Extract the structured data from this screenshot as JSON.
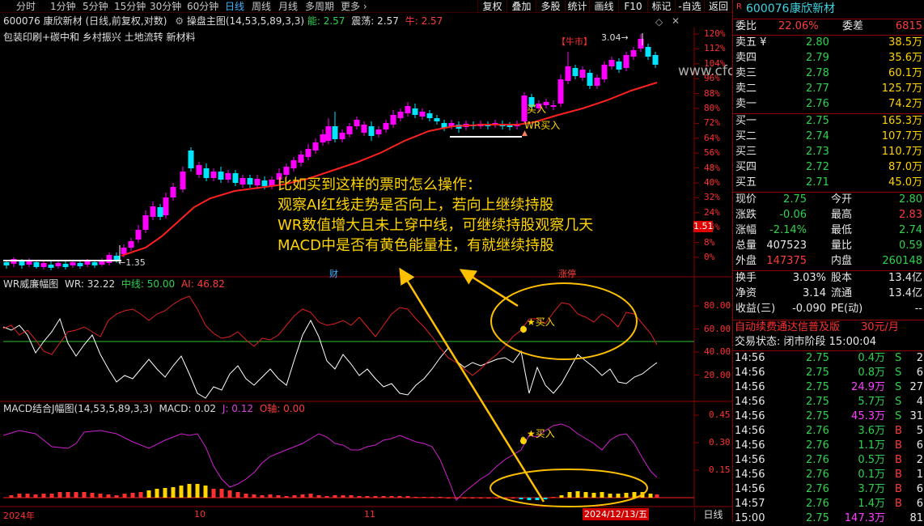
{
  "toolbar": {
    "periods": [
      "分时",
      "1分钟",
      "5分钟",
      "15分钟",
      "30分钟",
      "60分钟",
      "日线",
      "周线",
      "月线",
      "多周期",
      "更多 ›"
    ],
    "selected_period": "日线",
    "buttons": [
      "复权",
      "叠加",
      "多股",
      "统计",
      "画线",
      "F10",
      "标记",
      "-自选",
      "返回"
    ]
  },
  "main_panel": {
    "title": "600076 康欣新材 (日线,前复权,对数)",
    "indicator": "操盘主图(14,53,5,89,3,3)",
    "neng_label": "能:",
    "neng_value": "2.57",
    "zhen_label": "震荡:",
    "zhen_value": "2.57",
    "niu_label": "牛:",
    "niu_value": "2.57",
    "concepts": "包装印刷+碳中和 乡村振兴 土地流转 新材料",
    "pct_ticks": [
      "120%",
      "112%",
      "104%",
      "96%",
      "88%",
      "80%",
      "72%",
      "64%",
      "56%",
      "48%",
      "40%",
      "32%",
      "24%",
      "16%",
      "8%",
      "0%"
    ],
    "price_tag": "1.51",
    "low_label": "1.35",
    "high_label": "3.04",
    "niushi_label": "【牛市】",
    "buy_label": "买入",
    "wr_buy_label": "WR买入",
    "cai_label": "财",
    "zhangting_label": "涨停",
    "watermark": "www.cfchi.com"
  },
  "annotation": {
    "lines": [
      "比如买到这样的票时怎么操作：",
      "观察AI红线走势是否向上，若向上继续持股",
      "WR数值增大且未上穿中线，可继续持股观察几天",
      "MACD中是否有黄色能量柱，有就继续持股"
    ]
  },
  "wr_panel": {
    "title": "WR威廉幅图",
    "wr_label": "WR: 32.22",
    "mid_label": "中线: 50.00",
    "ai_label": "AI: 46.82",
    "ticks": [
      "80.00",
      "60.00",
      "40.00",
      "20.00"
    ],
    "buy_label": "★买入"
  },
  "macd_panel": {
    "title": "MACD结合J幅图(14,53,5,89,3,3)",
    "macd_label": "MACD: 0.02",
    "j_label": "J: 0.12",
    "o_label": "O轴: 0.00",
    "ticks": [
      "0.45",
      "0.30",
      "0.15"
    ],
    "buy_label": "★买入"
  },
  "xaxis": {
    "labels": [
      "2024年",
      "10",
      "11"
    ],
    "date_box": "2024/12/13/五",
    "period_btn": "日线"
  },
  "quote": {
    "code": "600076",
    "name": "康欣新材",
    "weibi_label": "委比",
    "weibi": "22.06%",
    "weicha_label": "委差",
    "weicha": "6815",
    "asks": [
      {
        "label": "卖五 ¥",
        "price": "2.80",
        "vol": "38.5万"
      },
      {
        "label": "卖四",
        "price": "2.79",
        "vol": "35.6万"
      },
      {
        "label": "卖三",
        "price": "2.78",
        "vol": "60.1万"
      },
      {
        "label": "卖二",
        "price": "2.77",
        "vol": "125.7万"
      },
      {
        "label": "卖一",
        "price": "2.76",
        "vol": "74.2万"
      }
    ],
    "bids": [
      {
        "label": "买一",
        "price": "2.75",
        "vol": "165.3万"
      },
      {
        "label": "买二",
        "price": "2.74",
        "vol": "107.7万"
      },
      {
        "label": "买三",
        "price": "2.73",
        "vol": "110.7万"
      },
      {
        "label": "买四",
        "price": "2.72",
        "vol": "87.0万"
      },
      {
        "label": "买五",
        "price": "2.71",
        "vol": "45.0万"
      }
    ],
    "stats": [
      {
        "l1": "现价",
        "v1": "2.75",
        "c1": "g",
        "l2": "今开",
        "v2": "2.80",
        "c2": "g"
      },
      {
        "l1": "涨跌",
        "v1": "-0.06",
        "c1": "g",
        "l2": "最高",
        "v2": "2.83",
        "c2": "r"
      },
      {
        "l1": "涨幅",
        "v1": "-2.14%",
        "c1": "g",
        "l2": "最低",
        "v2": "2.74",
        "c2": "g"
      },
      {
        "l1": "总量",
        "v1": "407523",
        "c1": "w",
        "l2": "量比",
        "v2": "0.59",
        "c2": "g"
      },
      {
        "l1": "外盘",
        "v1": "147375",
        "c1": "r",
        "l2": "内盘",
        "v2": "260148",
        "c2": "g"
      }
    ],
    "stats2": [
      {
        "l1": "换手",
        "v1": "3.03%",
        "l2": "股本",
        "v2": "13.4亿"
      },
      {
        "l1": "净资",
        "v1": "3.14",
        "l2": "流通",
        "v2": "13.4亿"
      },
      {
        "l1": "收益(三)",
        "v1": "-0.090",
        "l2": "PE(动)",
        "v2": "--"
      }
    ],
    "promo": "自动续费通达信普及版",
    "promo_price": "30元/月",
    "trade_status": "交易状态: 闭市阶段 15:00:04",
    "ticks": [
      {
        "t": "14:56",
        "p": "2.75",
        "v": "0.4万",
        "d": "S",
        "n": "2",
        "vc": "g"
      },
      {
        "t": "14:56",
        "p": "2.75",
        "v": "0.8万",
        "d": "S",
        "n": "6",
        "vc": "g"
      },
      {
        "t": "14:56",
        "p": "2.75",
        "v": "24.9万",
        "d": "S",
        "n": "27",
        "vc": "m"
      },
      {
        "t": "14:56",
        "p": "2.75",
        "v": "5.7万",
        "d": "S",
        "n": "4",
        "vc": "g"
      },
      {
        "t": "14:56",
        "p": "2.75",
        "v": "45.3万",
        "d": "S",
        "n": "31",
        "vc": "m"
      },
      {
        "t": "14:56",
        "p": "2.76",
        "v": "3.6万",
        "d": "B",
        "n": "5",
        "vc": "g"
      },
      {
        "t": "14:56",
        "p": "2.76",
        "v": "1.1万",
        "d": "B",
        "n": "6",
        "vc": "g"
      },
      {
        "t": "14:56",
        "p": "2.76",
        "v": "0.5万",
        "d": "B",
        "n": "2",
        "vc": "g"
      },
      {
        "t": "14:56",
        "p": "2.76",
        "v": "0.1万",
        "d": "B",
        "n": "1",
        "vc": "g"
      },
      {
        "t": "14:56",
        "p": "2.76",
        "v": "3.7万",
        "d": "B",
        "n": "6",
        "vc": "g"
      },
      {
        "t": "14:57",
        "p": "2.76",
        "v": "1.4万",
        "d": "B",
        "n": "6",
        "vc": "g"
      },
      {
        "t": "15:00",
        "p": "2.75",
        "v": "147.3万",
        "d": "",
        "n": "81",
        "vc": "m"
      }
    ]
  },
  "colors": {
    "up": "#ff00ff",
    "down": "#00e5ff",
    "red_line": "#ff2020",
    "wr_red": "#e02020",
    "j_line": "#d020d0",
    "yellow": "#ffd400",
    "border": "#8b0000",
    "flat": "#ffffff"
  }
}
